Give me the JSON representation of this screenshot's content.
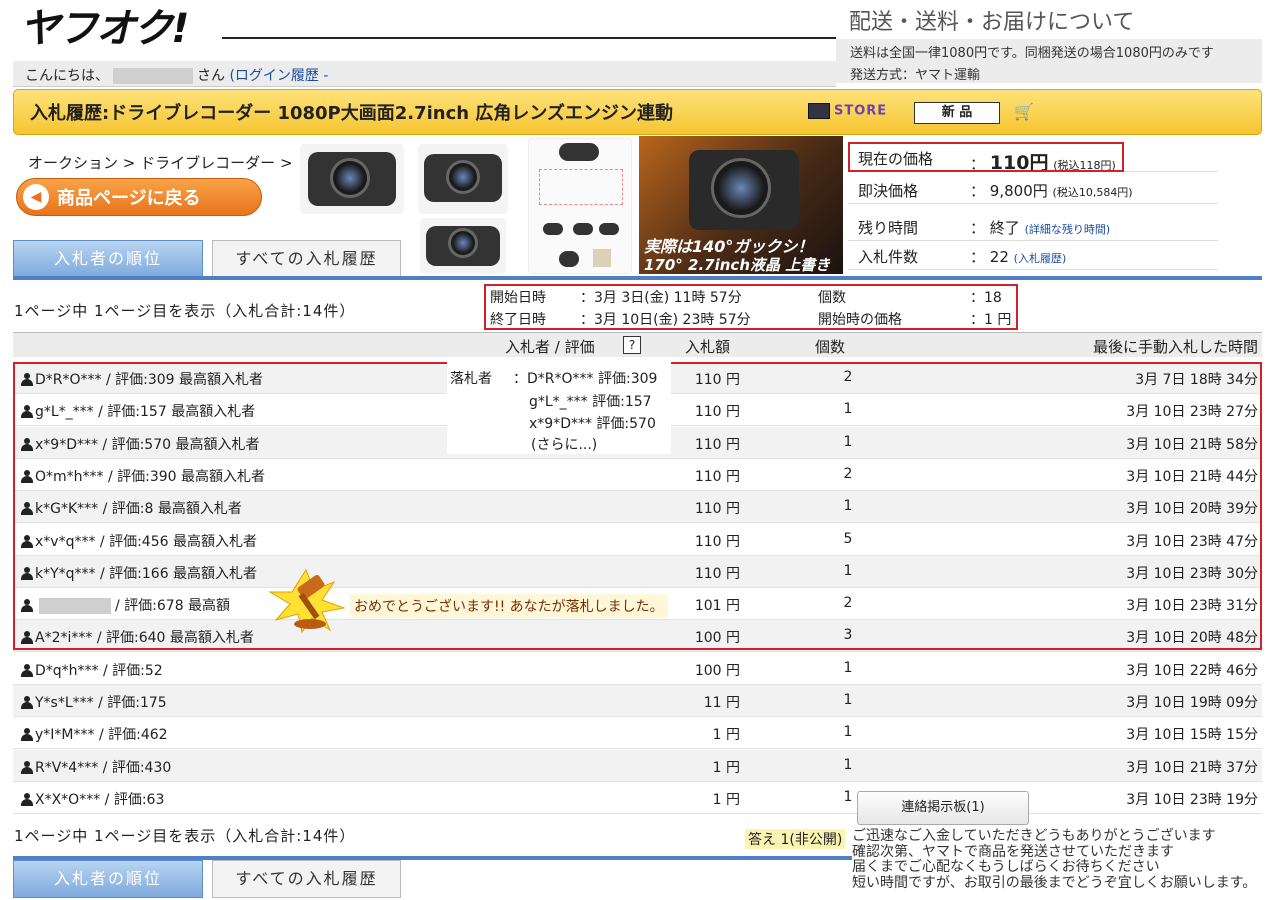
{
  "logo": {
    "text": "ヤフオク!"
  },
  "shipping": {
    "title": "配送・送料・お届けについて",
    "line1": "送料は全国一律1080円です。同梱発送の場合1080円のみです",
    "line2": "発送方式：ヤマト運輸"
  },
  "greeting": {
    "prefix": "こんにちは、",
    "suffix": "さん",
    "login_history": "(ログイン履歴 -"
  },
  "title_bar": {
    "text": "入札履歴:ドライブレコーダー 1080P大画面2.7inch 広角レンズエンジン連動",
    "store_badge": "STORE",
    "new_badge": "新 品"
  },
  "breadcrumb": {
    "item1": "オークション",
    "sep": ">",
    "item2": "ドライブレコーダー",
    "sep2": ">"
  },
  "back_button": {
    "label": "商品ページに戻る"
  },
  "tabs": {
    "ranking": "入札者の順位",
    "all_history": "すべての入札履歴"
  },
  "banner": {
    "text1": "実際は140°ガックシ！",
    "text2": "170° 2.7inch液晶 上書き"
  },
  "price": {
    "current_label": "現在の価格",
    "current_value": "110円",
    "current_tax": "(税込118円)",
    "buyout_label": "即決価格",
    "buyout_value": "9,800円",
    "buyout_tax": "(税込10,584円)",
    "remaining_label": "残り時間",
    "remaining_value": "終了",
    "remaining_link": "(詳細な残り時間)",
    "bids_label": "入札件数",
    "bids_value": "22",
    "bids_link": "(入札履歴)",
    "colon": "："
  },
  "page_info": "1ページ中 1ページ目を表示（入札合計:14件）",
  "times": {
    "start_label": "開始日時",
    "start_value": "：3月 3日(金) 11時 57分",
    "end_label": "終了日時",
    "end_value": "：3月 10日(金) 23時 57分",
    "qty_label": "個数",
    "qty_value": "：18",
    "start_price_label": "開始時の価格",
    "start_price_value": "：1 円"
  },
  "table": {
    "headers": {
      "bidder": "入札者 / 評価",
      "help": "?",
      "amount": "入札額",
      "qty": "個数",
      "last_time": "最後に手動入札した時間"
    },
    "rows": [
      {
        "bidder": "D*R*O*** / 評価:309 最高額入札者",
        "amount": "110 円",
        "qty": "2",
        "time": "3月 7日 18時 34分"
      },
      {
        "bidder": "g*L*_*** / 評価:157 最高額入札者",
        "amount": "110 円",
        "qty": "1",
        "time": "3月 10日 23時 27分"
      },
      {
        "bidder": "x*9*D*** / 評価:570 最高額入札者",
        "amount": "110 円",
        "qty": "1",
        "time": "3月 10日 21時 58分"
      },
      {
        "bidder": "O*m*h*** / 評価:390 最高額入札者",
        "amount": "110 円",
        "qty": "2",
        "time": "3月 10日 21時 44分"
      },
      {
        "bidder": "k*G*K*** / 評価:8 最高額入札者",
        "amount": "110 円",
        "qty": "1",
        "time": "3月 10日 20時 39分"
      },
      {
        "bidder": "x*v*q*** / 評価:456 最高額入札者",
        "amount": "110 円",
        "qty": "5",
        "time": "3月 10日 23時 47分"
      },
      {
        "bidder": "k*Y*q*** / 評価:166 最高額入札者",
        "amount": "110 円",
        "qty": "1",
        "time": "3月 10日 23時 30分"
      },
      {
        "bidder": "/ 評価:678 最高額",
        "amount": "101 円",
        "qty": "2",
        "time": "3月 10日 23時 31分"
      },
      {
        "bidder": "A*2*i*** / 評価:640 最高額入札者",
        "amount": "100 円",
        "qty": "3",
        "time": "3月 10日 20時 48分"
      },
      {
        "bidder": "D*q*h*** / 評価:52",
        "amount": "100 円",
        "qty": "1",
        "time": "3月 10日 22時 46分"
      },
      {
        "bidder": "Y*s*L*** / 評価:175",
        "amount": "11 円",
        "qty": "1",
        "time": "3月 10日 19時 09分"
      },
      {
        "bidder": "y*I*M*** / 評価:462",
        "amount": "1 円",
        "qty": "1",
        "time": "3月 10日 15時 15分"
      },
      {
        "bidder": "R*V*4*** / 評価:430",
        "amount": "1 円",
        "qty": "1",
        "time": "3月 10日 21時 37分"
      },
      {
        "bidder": "X*X*O*** / 評価:63",
        "amount": "1 円",
        "qty": "1",
        "time": "3月 10日 23時 19分"
      }
    ]
  },
  "winners": {
    "label": "落札者",
    "line1": "：D*R*O*** 評価:309",
    "line2": "g*L*_*** 評価:157",
    "line3": "x*9*D*** 評価:570",
    "more": "(さらに...)"
  },
  "congrats": {
    "text": "おめでとうございます!! あなたが落札しました。"
  },
  "contact_button": {
    "label": "連絡掲示板(1)"
  },
  "answer_label": "答え 1(非公開)",
  "message": {
    "line1": "ご迅速なご入金していただきどうもありがとうございます",
    "line2": "確認次第、ヤマトで商品を発送させていただきます",
    "line3": "届くまでご心配なくもうしばらくお待ちください",
    "line4": "短い時間ですが、お取引の最後までどうぞ宜しくお願いします。"
  },
  "colors": {
    "accent_red": "#d4202a",
    "title_yellow": "#f6c531",
    "tab_blue": "#7ea9dc",
    "button_orange": "#e8731c"
  }
}
